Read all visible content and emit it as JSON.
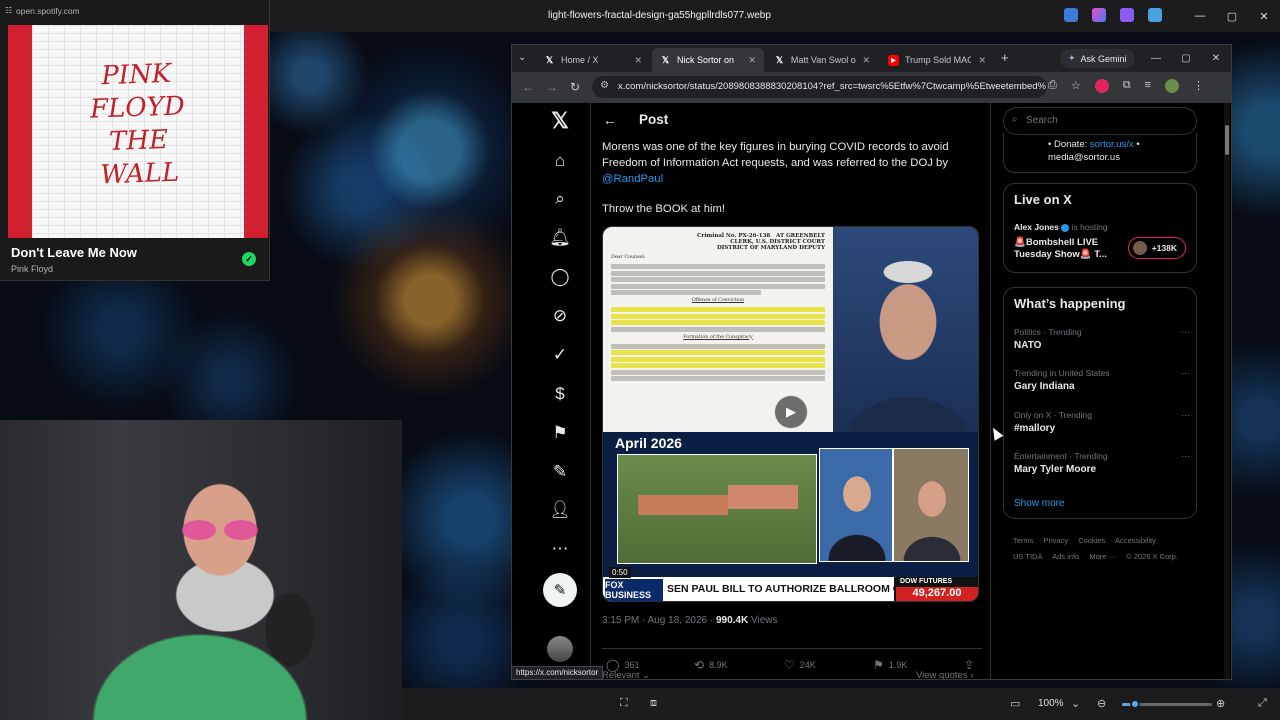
{
  "viewer": {
    "title": "light-flowers-fractal-design-ga55hgpllrdls077.webp",
    "zoom": "100%",
    "zoom_level": 0.14,
    "controls": {
      "minimize": "—",
      "maximize": "▢",
      "close": "✕"
    }
  },
  "spotify": {
    "url": "open.spotify.com",
    "album_art_text": [
      "PINK",
      "FLOYD",
      "THE",
      "WALL"
    ],
    "track_title": "Don't Leave Me Now",
    "artist": "Pink Floyd"
  },
  "browser": {
    "tabs": [
      {
        "label": "Home / X",
        "icon": "x-icon",
        "active": false
      },
      {
        "label": "Nick Sortor on X: \"",
        "icon": "x-icon",
        "active": true
      },
      {
        "label": "Matt Van Swol on ",
        "icon": "x-icon",
        "active": false
      },
      {
        "label": "Trump Sold MAGA",
        "icon": "youtube-icon",
        "active": false
      }
    ],
    "ask_gemini": "Ask Gemini",
    "url": "x.com/nicksortor/status/2089808388830208104?ref_src=twsrc%5Etfw%7Ctwcamp%5Etweetembed%...",
    "status_url": "https://x.com/nicksortor"
  },
  "post": {
    "header": "Post",
    "text": "Morens was one of the key figures in burying COVID records to avoid Freedom of Information Act requests, and was referred to the DOJ by",
    "mention": "@RandPaul",
    "text2": "Throw the BOOK at him!",
    "media": {
      "doc_header": [
        "Criminal No. PX-26-138",
        "AT GREENBELT",
        "CLERK, U.S. DISTRICT COURT",
        "DISTRICT OF MARYLAND",
        "DEPUTY"
      ],
      "doc_salutation": "Dear Counsel:",
      "doc_section_1": "Offense of Conviction",
      "doc_section_2": "Formation of the Conspiracy",
      "news_date": "April 2026",
      "ticker_brand": "FOX BUSINESS",
      "ticker_time": "0:50",
      "ticker_text": "SEN PAUL BILL TO AUTHORIZE BALLROOM CONSTRUCTION",
      "dow_label": "DOW FUTURES",
      "dow_value": "49,267.00"
    },
    "time": "3:15 PM · Aug 18, 2026 ·",
    "views_count": "990.4K",
    "views_label": "Views",
    "actions": {
      "replies": "361",
      "reposts": "8.9K",
      "likes": "24K",
      "bookmarks": "1.9K"
    },
    "relevant": "Relevant",
    "view_quotes": "View quotes"
  },
  "sidebar": {
    "search_placeholder": "Search",
    "donate_label": "• Donate:",
    "donate_link": "sortor.us/x",
    "donate_email": "media@sortor.us",
    "live": {
      "title": "Live on X",
      "host": "Alex Jones",
      "host_suffix": "is hosting",
      "show": "🚨Bombshell LIVE Tuesday Show🚨 T...",
      "count": "+138K"
    },
    "happening": {
      "title": "What’s happening",
      "trends": [
        {
          "meta": "Politics · Trending",
          "name": "NATO"
        },
        {
          "meta": "Trending in United States",
          "name": "Gary Indiana"
        },
        {
          "meta": "Only on X · Trending",
          "name": "#mallory"
        },
        {
          "meta": "Entertainment · Trending",
          "name": "Mary Tyler Moore"
        }
      ],
      "show_more": "Show more"
    },
    "footer": [
      "Terms",
      "Privacy",
      "Cookies",
      "Accessibility",
      "US TIDA",
      "Ads info",
      "More ···",
      "© 2026 X Corp."
    ]
  }
}
